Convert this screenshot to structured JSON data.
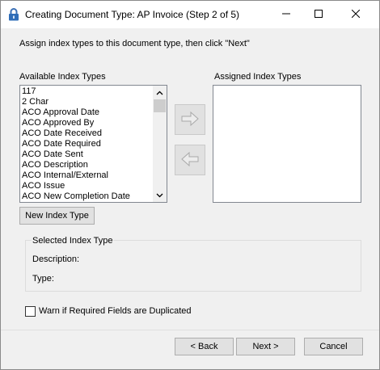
{
  "window": {
    "title": "Creating Document Type: AP Invoice (Step 2 of 5)",
    "icon": "lock-icon",
    "controls": [
      "minimize-icon",
      "maximize-icon",
      "close-icon"
    ]
  },
  "instruction": "Assign index types to this document type, then click \"Next\"",
  "available": {
    "label": "Available Index Types",
    "items": [
      "117",
      "2 Char",
      "ACO Approval Date",
      "ACO Approved By",
      "ACO Date Received",
      "ACO Date Required",
      "ACO Date Sent",
      "ACO Description",
      "ACO Internal/External",
      "ACO Issue",
      "ACO New Completion Date"
    ]
  },
  "assigned": {
    "label": "Assigned Index Types",
    "items": []
  },
  "buttons": {
    "add_icon": "right-arrow-icon",
    "remove_icon": "left-arrow-icon",
    "new_index_type": "New Index Type"
  },
  "selected_group": {
    "title": "Selected Index Type",
    "description_label": "Description:",
    "type_label": "Type:"
  },
  "warn_checkbox": {
    "label": "Warn if Required Fields are Duplicated",
    "checked": false
  },
  "footer": {
    "back": "< Back",
    "next": "Next >",
    "cancel": "Cancel"
  }
}
